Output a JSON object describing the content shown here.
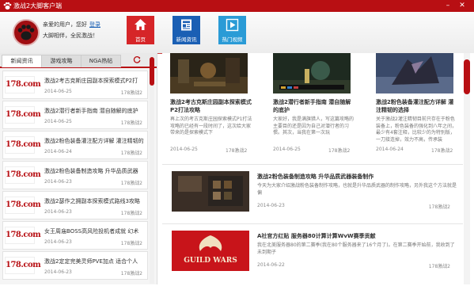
{
  "window": {
    "title": "激战2大脚客户端"
  },
  "user": {
    "welcome": "亲爱的用户，您好",
    "login": "登录",
    "slogan": "大脚相伴，全民激战！"
  },
  "nav": [
    {
      "label": "首页",
      "color": "#d62528"
    },
    {
      "label": "新闻资讯",
      "color": "#1a5fb4"
    },
    {
      "label": "热门视频",
      "color": "#2a9bd6"
    }
  ],
  "tabs": [
    "新闻资讯",
    "游戏攻略",
    "NGA热帖"
  ],
  "list": [
    {
      "logo": "178.com",
      "title": "激战2考古克斯庄园副本探索模式P2打",
      "date": "2014-06-25",
      "source": "178激战2"
    },
    {
      "logo": "178.com",
      "title": "激战2潜行者新手指南 潜自随解的底护",
      "date": "2014-06-25",
      "source": "178激战2"
    },
    {
      "logo": "178.com",
      "title": "激战2粉色装备灌注配方详解 灌注精韧的",
      "date": "2014-06-24",
      "source": "178激战2"
    },
    {
      "logo": "178.com",
      "title": "激战2粉色装备制造攻略 升华品质武器",
      "date": "2014-06-23",
      "source": "178激战2"
    },
    {
      "logo": "178.com",
      "title": "激战2瑟作之拥副本探索模式路线3攻略",
      "date": "2014-06-23",
      "source": "178激战2"
    },
    {
      "logo": "178.com",
      "title": "女王周庙BOSS高风险投机者成就 幻术",
      "date": "2014-06-23",
      "source": "178激战2"
    },
    {
      "logo": "178.com",
      "title": "激战2定定完美灵师PVE加点 适合个人",
      "date": "2014-06-23",
      "source": "178激战2"
    }
  ],
  "cards": [
    {
      "title": "激战2考古克斯庄园副本探索模式P2打法攻略",
      "desc": "再上次的考古克斯庄园探索模式P1打法攻略的已经有一段时间了，这次给大家带来的是探索模式下",
      "date": "2014-06-25",
      "source": "178激战2",
      "image": "dungeon-scene"
    },
    {
      "title": "激战2潜行者新手指南 潜自随解的底护",
      "desc": "大家好，我是满旗猎人，写这篇攻略的主要目的还是因为自己对潜行者的习惯。其次，当我在第一次玩",
      "date": "2014-06-25",
      "source": "178激战2",
      "image": "battle-scene"
    },
    {
      "title": "激战2粉色装备灌注配方详解 灌注精韧的选择",
      "desc": "关于激战2灌注精韧目前只存在于粉色装备上，粉色装备的强化到八年之间，最少有4套注释，比较少的为特别版，一刀接连掉，效力不高，传承装",
      "date": "2014-06-24",
      "source": "178激战2",
      "image": "dragon-scene"
    }
  ],
  "rows": [
    {
      "title": "激战2粉色装备制造攻略 升华品质武器装备制作",
      "desc": "今天为大家介绍激战粉色装备制作攻略，也就是升华品质武器的制作攻略，另外我这个方法就是偏",
      "date": "2014-06-23",
      "source": "178激战2",
      "image": "forge-scene"
    },
    {
      "title": "A社官方红贴 服务器80计算计算WvW赛季贡献",
      "desc": "我在北美服务器80的第二赛季(我在80个服务器来了16个月了)。在第二赛季开始前，我收到了未到期子",
      "date": "2014-06-22",
      "source": "178激战2",
      "image": "guildwars-logo",
      "logo_text": "GUILD WARS"
    }
  ]
}
